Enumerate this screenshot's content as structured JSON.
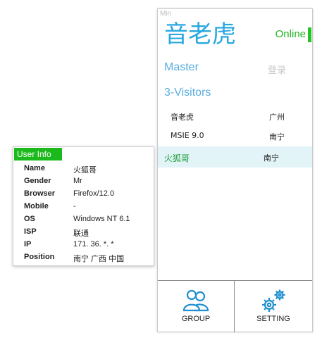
{
  "panel": {
    "min_label": "Min",
    "nickname": "音老虎",
    "status": "Online",
    "status_color": "#22c322",
    "master_label": "Master",
    "login_label": "登录",
    "visitors_title": "3-Visitors",
    "visitors": [
      {
        "name": "音老虎",
        "location": "广州"
      },
      {
        "name": "MSIE 9.0",
        "location": "南宁"
      },
      {
        "name": "火狐哥",
        "location": "南宁",
        "selected": true
      }
    ],
    "bottom": {
      "group_label": "GROUP",
      "group_icon": "group-users-icon",
      "setting_label": "SETTING",
      "setting_icon": "gears-icon"
    }
  },
  "user_info": {
    "title": "User Info",
    "fields": [
      {
        "key": "Name",
        "value": "火狐哥"
      },
      {
        "key": "Gender",
        "value": "Mr"
      },
      {
        "key": "Browser",
        "value": "Firefox/12.0"
      },
      {
        "key": "Mobile",
        "value": "-"
      },
      {
        "key": "OS",
        "value": "Windows NT 6.1"
      },
      {
        "key": "ISP",
        "value": "联通"
      },
      {
        "key": "IP",
        "value": "171. 36. *. *"
      },
      {
        "key": "Position",
        "value": "南宁 广西 中国"
      }
    ]
  },
  "colors": {
    "accent_blue": "#29a8e0",
    "online_green": "#22b222",
    "selected_row_bg": "#e2f4f7",
    "info_title_bg": "#1bb91b"
  }
}
